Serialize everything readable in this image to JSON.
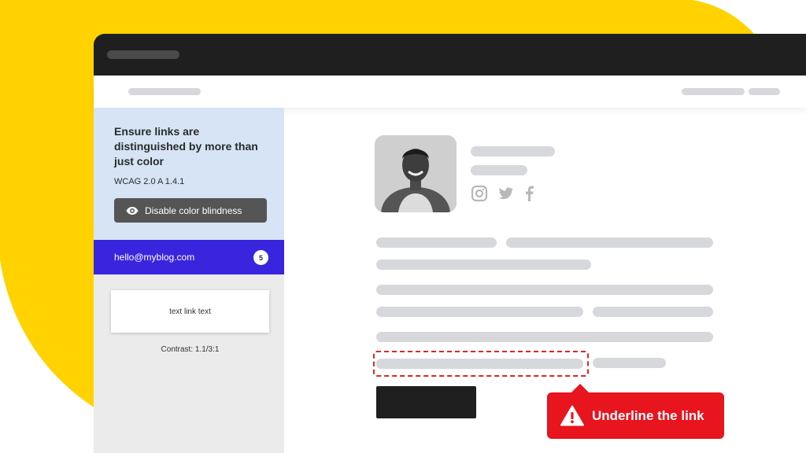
{
  "rule": {
    "title": "Ensure links are distinguished by more than just color",
    "code": "WCAG 2.0 A 1.4.1",
    "toggle_label": "Disable color blindness"
  },
  "issue": {
    "email": "hello@myblog.com",
    "count": "5"
  },
  "preview": {
    "sample_text": "text link text",
    "contrast_label": "Contrast: 1.1/3:1"
  },
  "tooltip": {
    "message": "Underline the link"
  },
  "social_icons": [
    "instagram-icon",
    "twitter-icon",
    "facebook-icon"
  ],
  "colors": {
    "accent_yellow": "#ffd200",
    "rule_bg": "#d6e4f5",
    "issue_bar": "#3a25de",
    "alert_red": "#e8141e"
  }
}
